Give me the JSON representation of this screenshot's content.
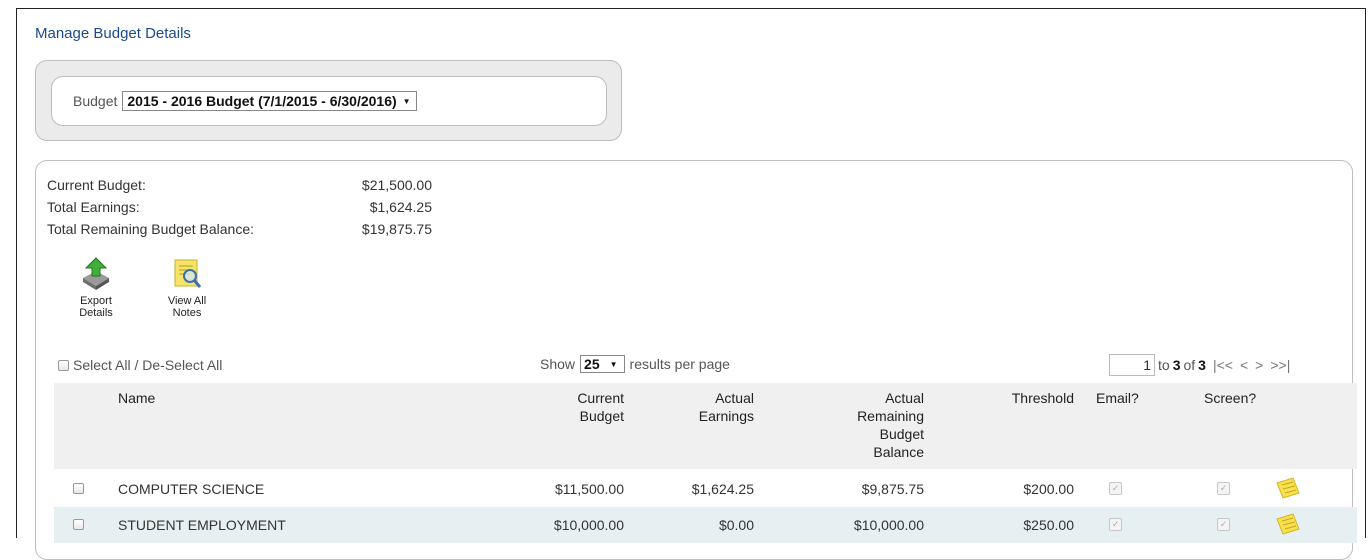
{
  "header": {
    "title": "Manage Budget Details"
  },
  "filter": {
    "label": "Budget",
    "selected": "2015 - 2016 Budget (7/1/2015 - 6/30/2016)"
  },
  "summary": {
    "current_budget_label": "Current Budget:",
    "current_budget_value": "$21,500.00",
    "total_earnings_label": "Total Earnings:",
    "total_earnings_value": "$1,624.25",
    "remaining_label": "Total Remaining Budget Balance:",
    "remaining_value": "$19,875.75"
  },
  "toolbar": {
    "export_line1": "Export",
    "export_line2": "Details",
    "notes_line1": "View All",
    "notes_line2": "Notes"
  },
  "list_controls": {
    "select_all_label": "Select All / De-Select All",
    "show_label": "Show",
    "per_page_value": "25",
    "per_page_suffix": "results per page"
  },
  "pager": {
    "page_value": "1",
    "to_text": "to",
    "range_end": "3",
    "of_text": "of",
    "total": "3",
    "first": "|<<",
    "prev": "<",
    "next": ">",
    "last": ">>|"
  },
  "table": {
    "headers": {
      "name": "Name",
      "current_budget_1": "Current",
      "current_budget_2": "Budget",
      "actual_earnings_1": "Actual",
      "actual_earnings_2": "Earnings",
      "remaining_1": "Actual",
      "remaining_2": "Remaining",
      "remaining_3": "Budget",
      "remaining_4": "Balance",
      "threshold": "Threshold",
      "email": "Email?",
      "screen": "Screen?"
    },
    "rows": [
      {
        "name": "COMPUTER SCIENCE",
        "current_budget": "$11,500.00",
        "actual_earnings": "$1,624.25",
        "remaining": "$9,875.75",
        "threshold": "$200.00",
        "email_checked": true,
        "screen_checked": true
      },
      {
        "name": "STUDENT EMPLOYMENT",
        "current_budget": "$10,000.00",
        "actual_earnings": "$0.00",
        "remaining": "$10,000.00",
        "threshold": "$250.00",
        "email_checked": true,
        "screen_checked": true
      }
    ]
  },
  "icons": {
    "export": "export-icon",
    "notes": "view-notes-icon",
    "row_note": "note-icon",
    "check": "check-icon"
  },
  "colors": {
    "title": "#1a4b8c",
    "row_alt": "#e6f0f2",
    "header_bg": "#f0f0f0"
  }
}
